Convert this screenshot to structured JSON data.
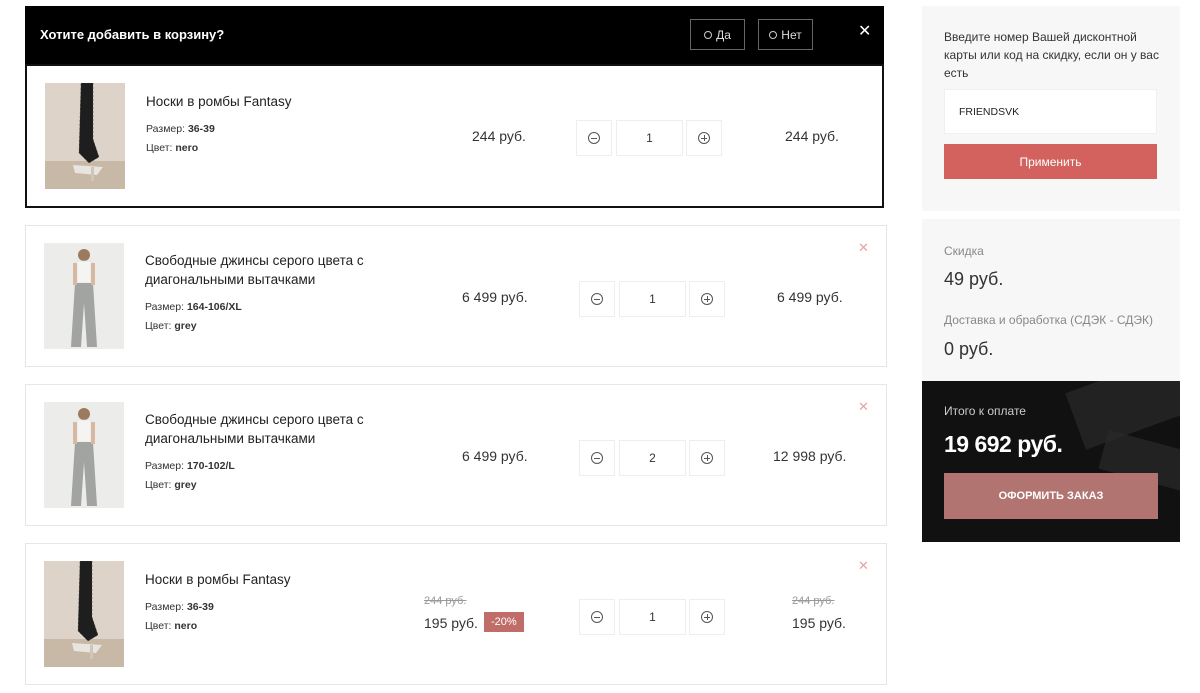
{
  "prompt": {
    "question": "Хотите добавить в корзину?",
    "yes_label": "Да",
    "no_label": "Нет",
    "close_icon": "close-icon"
  },
  "items": [
    {
      "name": "Носки в ромбы Fantasy",
      "size_label": "Размер:",
      "size": "36-39",
      "color_label": "Цвет:",
      "color": "nero",
      "price": "244 руб.",
      "qty": "1",
      "total": "244 руб."
    },
    {
      "name": "Свободные джинсы серого цвета с диагональными вытачками",
      "size_label": "Размер:",
      "size": "164-106/XL",
      "color_label": "Цвет:",
      "color": "grey",
      "price": "6 499 руб.",
      "qty": "1",
      "total": "6 499 руб."
    },
    {
      "name": "Свободные джинсы серого цвета с диагональными вытачками",
      "size_label": "Размер:",
      "size": "170-102/L",
      "color_label": "Цвет:",
      "color": "grey",
      "price": "6 499 руб.",
      "qty": "2",
      "total": "12 998 руб."
    },
    {
      "name": "Носки в ромбы Fantasy",
      "size_label": "Размер:",
      "size": "36-39",
      "color_label": "Цвет:",
      "color": "nero",
      "old_price": "244 руб.",
      "price": "195 руб.",
      "discount": "-20%",
      "qty": "1",
      "old_total": "244 руб.",
      "total": "195 руб."
    }
  ],
  "discount_card": {
    "label": "Введите номер Вашей дисконтной карты или код на скидку, если он у вас есть",
    "value": "FRIENDSVK",
    "apply_label": "Применить"
  },
  "summary": {
    "discount_label": "Скидка",
    "discount_value": "49 руб.",
    "delivery_label": "Доставка и обработка (СДЭК - СДЭК)",
    "delivery_value": "0 руб.",
    "total_label": "Итого к оплате",
    "total_value": "19 692 руб.",
    "order_label": "ОФОРМИТЬ ЗАКАЗ"
  },
  "colors": {
    "accent": "#d3625f",
    "order_button": "#b27470",
    "badge": "#c06d6a"
  }
}
